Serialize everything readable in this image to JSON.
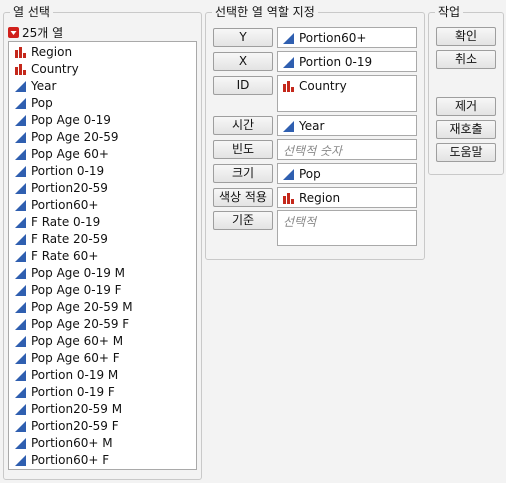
{
  "select_columns": {
    "title": "열 선택",
    "count_label": "25개 열",
    "items": [
      {
        "label": "Region",
        "type": "nominal"
      },
      {
        "label": "Country",
        "type": "nominal"
      },
      {
        "label": "Year",
        "type": "continuous"
      },
      {
        "label": "Pop",
        "type": "continuous"
      },
      {
        "label": "Pop Age 0-19",
        "type": "continuous"
      },
      {
        "label": "Pop Age 20-59",
        "type": "continuous"
      },
      {
        "label": "Pop Age 60+",
        "type": "continuous"
      },
      {
        "label": "Portion 0-19",
        "type": "continuous"
      },
      {
        "label": "Portion20-59",
        "type": "continuous"
      },
      {
        "label": "Portion60+",
        "type": "continuous"
      },
      {
        "label": "F Rate 0-19",
        "type": "continuous"
      },
      {
        "label": "F Rate 20-59",
        "type": "continuous"
      },
      {
        "label": "F Rate 60+",
        "type": "continuous"
      },
      {
        "label": "Pop Age 0-19 M",
        "type": "continuous"
      },
      {
        "label": "Pop Age 0-19 F",
        "type": "continuous"
      },
      {
        "label": "Pop Age 20-59 M",
        "type": "continuous"
      },
      {
        "label": "Pop Age 20-59 F",
        "type": "continuous"
      },
      {
        "label": "Pop Age 60+ M",
        "type": "continuous"
      },
      {
        "label": "Pop Age 60+ F",
        "type": "continuous"
      },
      {
        "label": "Portion 0-19 M",
        "type": "continuous"
      },
      {
        "label": "Portion 0-19 F",
        "type": "continuous"
      },
      {
        "label": "Portion20-59 M",
        "type": "continuous"
      },
      {
        "label": "Portion20-59 F",
        "type": "continuous"
      },
      {
        "label": "Portion60+ M",
        "type": "continuous"
      },
      {
        "label": "Portion60+ F",
        "type": "continuous"
      }
    ]
  },
  "roles": {
    "title": "선택한 열 역할 지정",
    "rows": [
      {
        "button": "Y",
        "value": "Portion60+",
        "value_type": "continuous",
        "placeholder": ""
      },
      {
        "button": "X",
        "value": "Portion 0-19",
        "value_type": "continuous",
        "placeholder": ""
      },
      {
        "button": "ID",
        "value": "Country",
        "value_type": "nominal",
        "placeholder": ""
      },
      {
        "button": "시간",
        "value": "Year",
        "value_type": "continuous",
        "placeholder": ""
      },
      {
        "button": "빈도",
        "value": "",
        "value_type": "",
        "placeholder": "선택적 숫자"
      },
      {
        "button": "크기",
        "value": "Pop",
        "value_type": "continuous",
        "placeholder": ""
      },
      {
        "button": "색상 적용",
        "value": "Region",
        "value_type": "nominal",
        "placeholder": ""
      },
      {
        "button": "기준",
        "value": "",
        "value_type": "",
        "placeholder": "선택적"
      }
    ]
  },
  "actions": {
    "title": "작업",
    "ok": "확인",
    "cancel": "취소",
    "remove": "제거",
    "recall": "재호출",
    "help": "도움말"
  },
  "colors": {
    "continuous_icon": "#2f5fb0",
    "nominal_icon": "#c4281b",
    "menu_triangle": "#d0201b"
  }
}
